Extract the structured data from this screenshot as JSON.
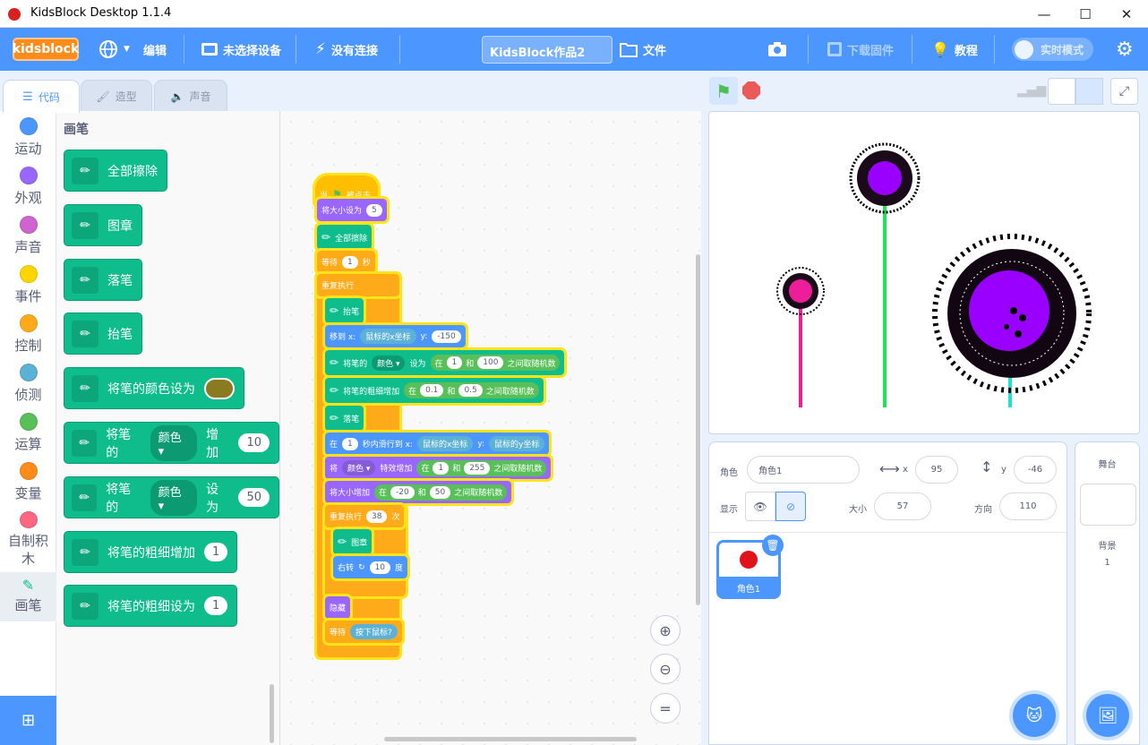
{
  "window": {
    "title": "KidsBlock Desktop 1.1.4",
    "minimize": "—",
    "maximize": "☐",
    "close": "✕"
  },
  "menu": {
    "logo": "kidsblock",
    "language_icon": "globe-icon",
    "edit": "编辑",
    "device": "未选择设备",
    "connection": "没有连接",
    "project_name": "KidsBlock作品2",
    "file": "文件",
    "download_firmware": "下载固件",
    "tutorial": "教程",
    "realtime_mode": "实时模式",
    "accent": "#4c97ff"
  },
  "tabs": {
    "code": "代码",
    "costume": "造型",
    "sound": "声音"
  },
  "categories": [
    {
      "label": "运动",
      "color": "#4c97ff"
    },
    {
      "label": "外观",
      "color": "#9966ff"
    },
    {
      "label": "声音",
      "color": "#cf63cf"
    },
    {
      "label": "事件",
      "color": "#ffd500"
    },
    {
      "label": "控制",
      "color": "#ffab19"
    },
    {
      "label": "侦测",
      "color": "#5cb1d6"
    },
    {
      "label": "运算",
      "color": "#59c059"
    },
    {
      "label": "变量",
      "color": "#ff8c1a"
    },
    {
      "label": "自制积木",
      "color": "#ff6680"
    },
    {
      "label": "画笔",
      "color": "#0fbd8c"
    }
  ],
  "palette": {
    "title": "画笔",
    "blocks": {
      "clear": "全部擦除",
      "stamp": "图章",
      "pen_down": "落笔",
      "pen_up": "抬笔",
      "set_color": "将笔的颜色设为",
      "change_param_pre": "将笔的",
      "change_param_dd": "颜色",
      "change_param_mid": "增加",
      "change_param_val": "10",
      "set_param_pre": "将笔的",
      "set_param_dd": "颜色",
      "set_param_mid": "设为",
      "set_param_val": "50",
      "change_size": "将笔的粗细增加",
      "change_size_val": "1",
      "set_size": "将笔的粗细设为",
      "set_size_val": "1",
      "swatch_color": "#8a7a20"
    }
  },
  "script": {
    "hat_when": "当",
    "hat_clicked": "被点击",
    "set_size": "将大小设为",
    "set_size_val": "5",
    "clear": "全部擦除",
    "wait": "等待",
    "wait_val": "1",
    "wait_unit": "秒",
    "forever": "重复执行",
    "pen_up": "抬笔",
    "goto_x": "移到 x:",
    "goto_x_rep": "鼠标的x坐标",
    "goto_y": "y:",
    "goto_y_val": "-150",
    "set_pen_pre": "将笔的",
    "set_pen_dd": "颜色",
    "set_pen_mid": "设为",
    "rand1_a": "在",
    "rand1_lo": "1",
    "rand1_and": "和",
    "rand1_hi": "100",
    "rand1_tail": "之间取随机数",
    "change_width": "将笔的粗细增加",
    "rand2_lo": "0.1",
    "rand2_hi": "0.5",
    "pen_down": "落笔",
    "glide_in": "在",
    "glide_val": "1",
    "glide_text": "秒内滑行到 x:",
    "glide_x": "鼠标的x坐标",
    "glide_y_label": "y:",
    "glide_y": "鼠标的y坐标",
    "effect_pre": "将",
    "effect_dd": "颜色",
    "effect_mid": "特效增加",
    "rand3_lo": "1",
    "rand3_hi": "255",
    "size_change": "将大小增加",
    "rand4_lo": "-20",
    "rand4_hi": "50",
    "repeat": "重复执行",
    "repeat_val": "38",
    "repeat_unit": "次",
    "stamp": "图章",
    "turn": "右转",
    "turn_val": "10",
    "turn_unit": "度",
    "hide": "隐藏",
    "wait_until": "等待",
    "mouse_down": "按下鼠标?"
  },
  "zoom": {
    "in_icon": "zoom-in-icon",
    "out_icon": "zoom-out-icon",
    "reset": "="
  },
  "sprite_info": {
    "sprite_label": "角色",
    "sprite_name": "角色1",
    "x_label": "x",
    "x_val": "95",
    "y_label": "y",
    "y_val": "-46",
    "show_label": "显示",
    "size_label": "大小",
    "size_val": "57",
    "direction_label": "方向",
    "direction_val": "110"
  },
  "sprites": [
    {
      "name": "角色1"
    }
  ],
  "stage_panel": {
    "title": "舞台",
    "backdrop_label": "背景",
    "backdrop_count": "1"
  }
}
